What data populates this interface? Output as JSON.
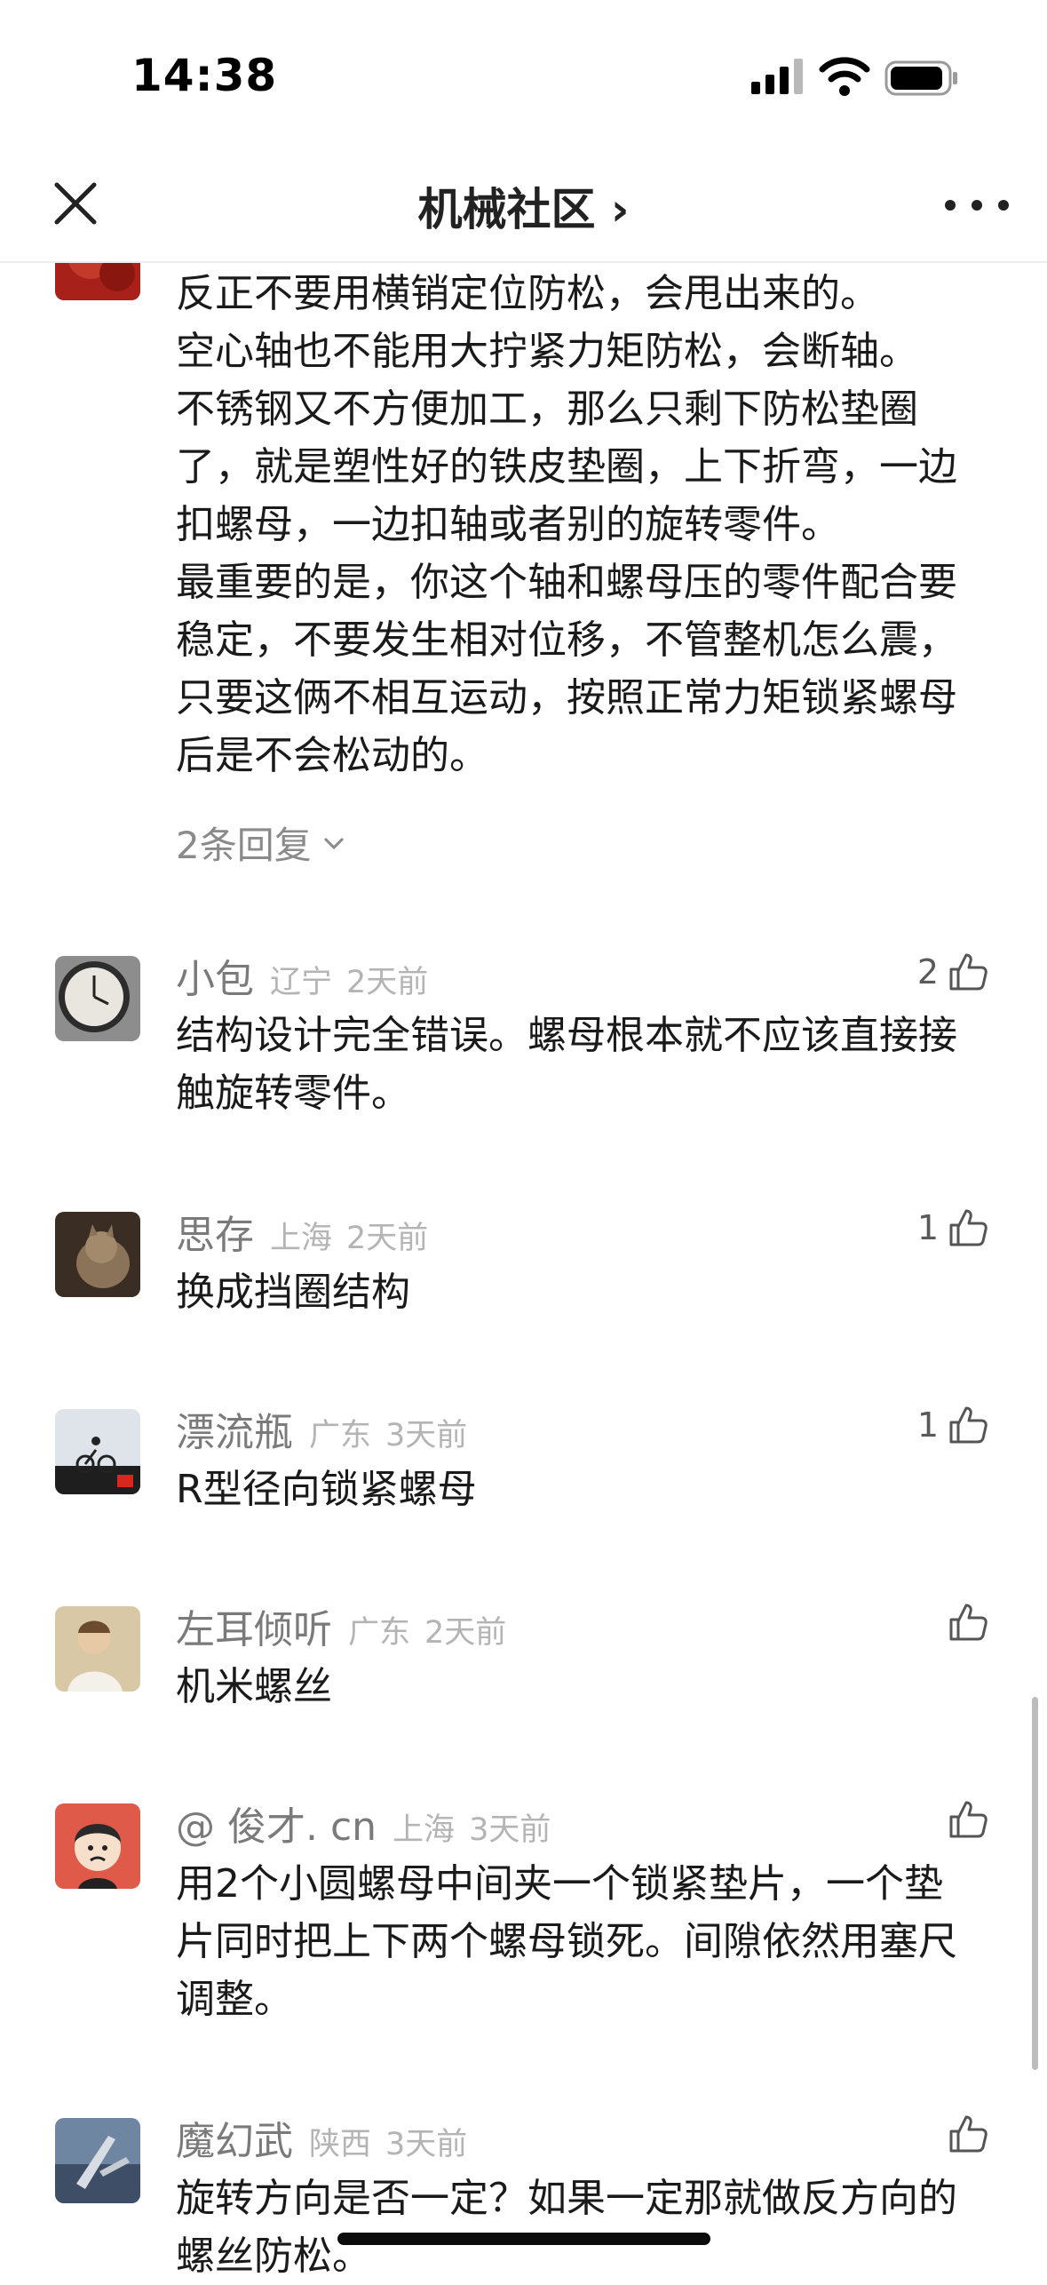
{
  "status_bar": {
    "time": "14:38"
  },
  "nav": {
    "title": "机械社区 ›"
  },
  "top_comment": {
    "text": "反正不要用横销定位防松，会甩出来的。\n空心轴也不能用大拧紧力矩防松，会断轴。\n不锈钢又不方便加工，那么只剩下防松垫圈\n了，就是塑性好的铁皮垫圈，上下折弯，一边\n扣螺母，一边扣轴或者别的旋转零件。\n最重要的是，你这个轴和螺母压的零件配合要\n稳定，不要发生相对位移，不管整机怎么震，\n只要这俩不相互运动，按照正常力矩锁紧螺母\n后是不会松动的。",
    "replies_label": "2条回复"
  },
  "comments": [
    {
      "name": "小包",
      "region": "辽宁",
      "time": "2天前",
      "likes": "2",
      "text": "结构设计完全错误。螺母根本就不应该直接接\n触旋转零件。"
    },
    {
      "name": "思存",
      "region": "上海",
      "time": "2天前",
      "likes": "1",
      "text": "换成挡圈结构"
    },
    {
      "name": "漂流瓶",
      "region": "广东",
      "time": "3天前",
      "likes": "1",
      "text": "R型径向锁紧螺母"
    },
    {
      "name": "左耳倾听",
      "region": "广东",
      "time": "2天前",
      "likes": "",
      "text": "机米螺丝"
    },
    {
      "name": "@ 俊才. cn",
      "region": "上海",
      "time": "3天前",
      "likes": "",
      "text": "用2个小圆螺母中间夹一个锁紧垫片，一个垫\n片同时把上下两个螺母锁死。间隙依然用塞尺\n调整。"
    },
    {
      "name": "魔幻武",
      "region": "陕西",
      "time": "3天前",
      "likes": "",
      "text": "旋转方向是否一定？如果一定那就做反方向的\n螺丝防松。"
    }
  ],
  "colors": {
    "text": "#1a1a1a",
    "name": "#7a7a7a",
    "meta": "#b4b4b4",
    "icon": "#555555"
  }
}
